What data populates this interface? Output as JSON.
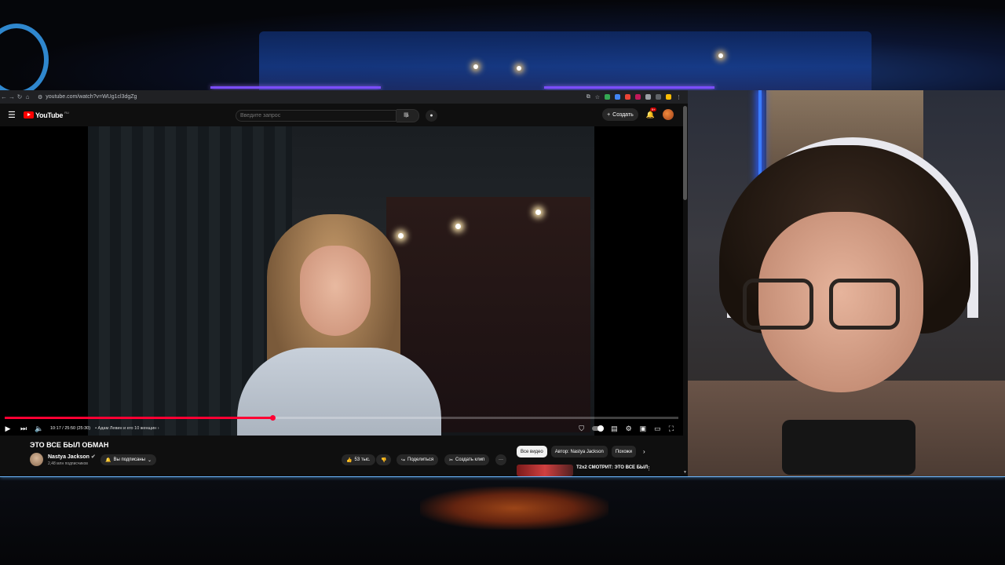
{
  "browser": {
    "url": "youtube.com/watch?v=WUg1cl3dgZg"
  },
  "youtube": {
    "logo_text": "YouTube",
    "logo_sup": "RU",
    "search_placeholder": "Введите запрос",
    "create_label": "Создать",
    "notifications_badge": "9+"
  },
  "player": {
    "time": "10:17 / 25:50 (25:30)",
    "chapter": "• Адам Левин и его 10 женщин ›",
    "progress_fraction": 0.398
  },
  "video": {
    "title": "ЭТО ВСЕ БЫЛ ОБМАН",
    "channel_name": "Nastya Jackson",
    "channel_subs": "2,48 млн подписчиков",
    "subscribed_label": "Вы подписаны",
    "likes": "53 тыс.",
    "share_label": "Поделиться",
    "clip_label": "Создать клип",
    "more_label": "···"
  },
  "related": {
    "chips": [
      "Все видео",
      "Автор: Nastya Jackson",
      "Похожи"
    ],
    "item_title": "Т2х2 СМОТРИТ: ЭТО ВСЕ БЫЛ"
  }
}
